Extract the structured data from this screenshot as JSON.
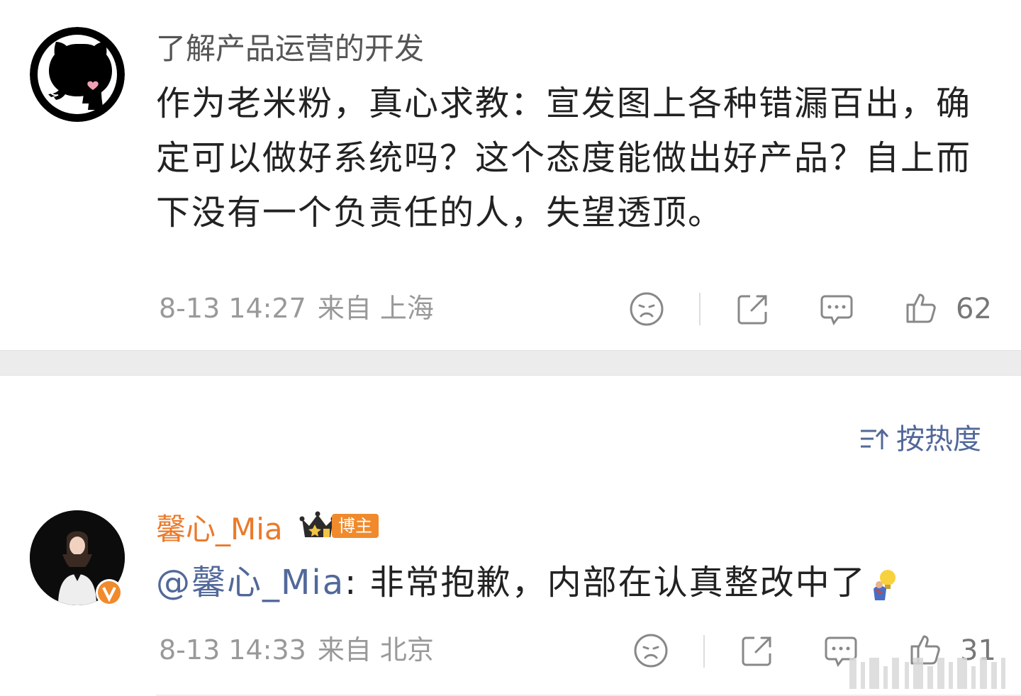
{
  "comment1": {
    "username": "了解产品运营的开发",
    "text": "作为老米粉，真心求教：宣发图上各种错漏百出，确定可以做好系统吗？这个态度能做出好产品？自上而下没有一个负责任的人，失望透顶。",
    "time": "8-13 14:27",
    "from": "来自 上海",
    "likes": "62"
  },
  "sort": {
    "label": "按热度"
  },
  "comment2": {
    "username": "馨心_Mia",
    "badge": "博主",
    "mention": "@馨心_Mia",
    "text": ": 非常抱歉，内部在认真整改中了",
    "time": "8-13 14:33",
    "from": "来自 北京",
    "likes": "31"
  },
  "colors": {
    "username_orange": "#ea7a2b",
    "mention_blue": "#52689a",
    "badge_orange": "#f08a2c",
    "meta_gray": "#999999"
  },
  "icons": [
    "github-cat-avatar-icon",
    "sad-face-icon",
    "share-icon",
    "comment-icon",
    "thumbs-up-icon",
    "sort-icon",
    "crown-icon",
    "bulb-emoji-icon",
    "verified-v-icon"
  ]
}
